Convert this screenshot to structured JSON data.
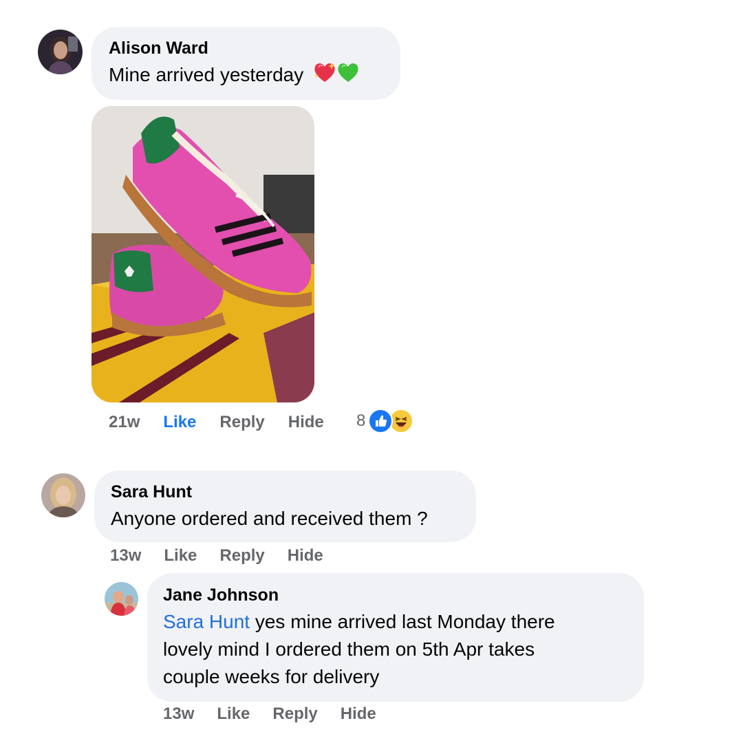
{
  "comments": [
    {
      "author": "Alison Ward",
      "text": "Mine arrived yesterday",
      "emojis": [
        "sparkling-heart",
        "green-heart"
      ],
      "has_photo": true,
      "photo_subject": "pink-green-suede-sneakers-on-yellow-box",
      "time": "21w",
      "like_label": "Like",
      "reply_label": "Reply",
      "hide_label": "Hide",
      "liked": true,
      "reaction_count": "8",
      "reaction_icons": [
        "like-icon",
        "haha-icon"
      ]
    },
    {
      "author": "Sara Hunt",
      "text": "Anyone ordered and received them ?",
      "time": "13w",
      "like_label": "Like",
      "reply_label": "Reply",
      "hide_label": "Hide",
      "liked": false
    }
  ],
  "reply": {
    "author": "Jane Johnson",
    "mention": "Sara Hunt",
    "text_line1": " yes mine arrived last Monday there",
    "text_line2": "lovely mind I ordered them on 5th Apr takes",
    "text_line3": "couple weeks for delivery",
    "time": "13w",
    "like_label": "Like",
    "reply_label": "Reply",
    "hide_label": "Hide"
  },
  "colors": {
    "bubble": "#f0f2f5",
    "text": "#050505",
    "meta": "#65676b",
    "link_blue": "#1877f2",
    "mention_blue": "#216fdb"
  }
}
